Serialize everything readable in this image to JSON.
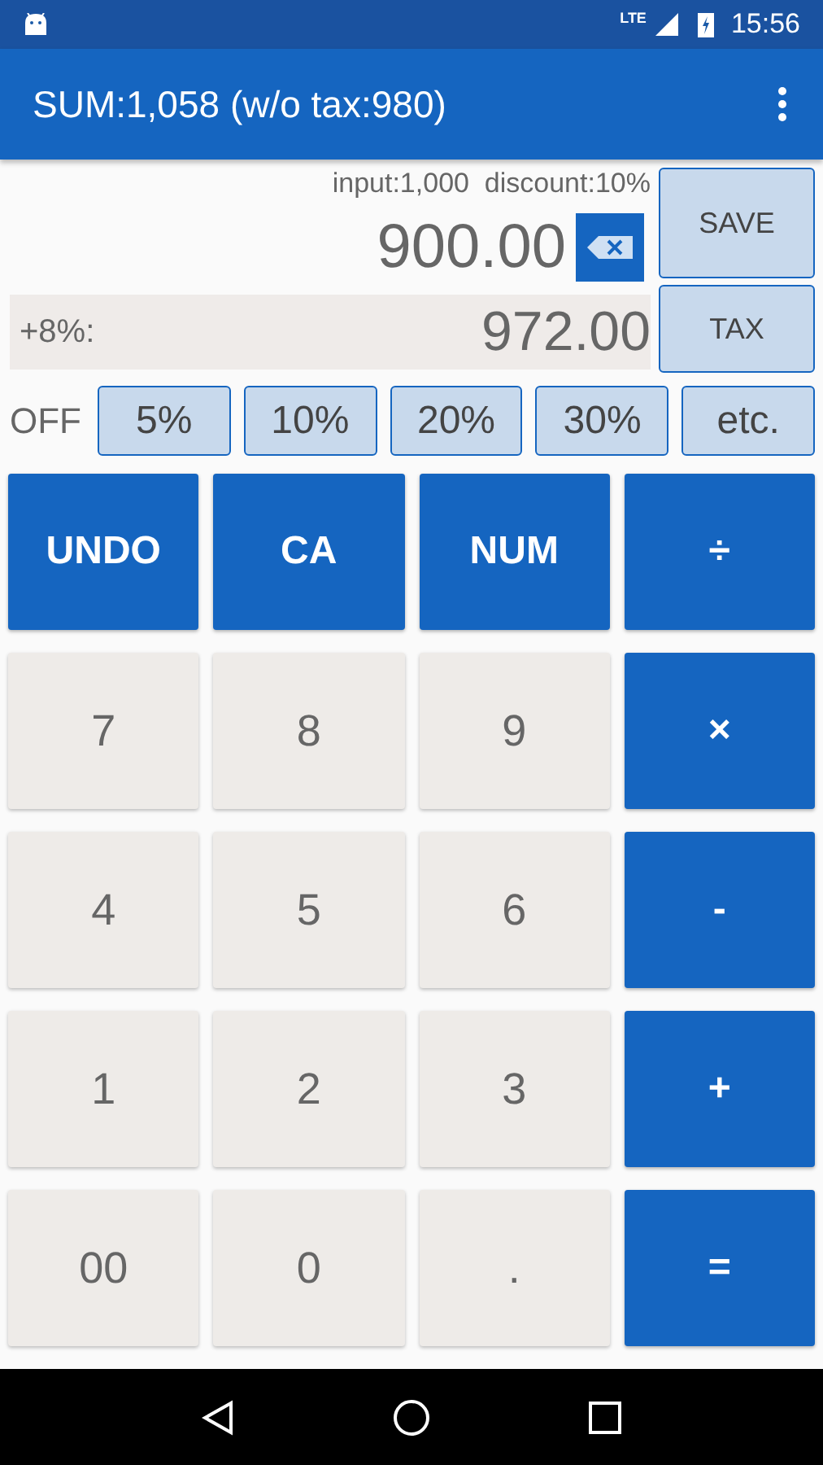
{
  "status_bar": {
    "time": "15:56",
    "network": "LTE"
  },
  "app_bar": {
    "title": "SUM:1,058 (w/o tax:980)"
  },
  "display": {
    "info": "input:1,000  discount:10%",
    "value": "900.00",
    "tax_label": "+8%:",
    "tax_value": "972.00"
  },
  "side_buttons": [
    "SAVE",
    "TAX"
  ],
  "discount": {
    "label": "OFF",
    "options": [
      "5%",
      "10%",
      "20%",
      "30%",
      "etc."
    ]
  },
  "keys": [
    {
      "label": "UNDO",
      "kind": "op"
    },
    {
      "label": "CA",
      "kind": "op"
    },
    {
      "label": "NUM",
      "kind": "op"
    },
    {
      "label": "÷",
      "kind": "op"
    },
    {
      "label": "7",
      "kind": "num"
    },
    {
      "label": "8",
      "kind": "num"
    },
    {
      "label": "9",
      "kind": "num"
    },
    {
      "label": "×",
      "kind": "op"
    },
    {
      "label": "4",
      "kind": "num"
    },
    {
      "label": "5",
      "kind": "num"
    },
    {
      "label": "6",
      "kind": "num"
    },
    {
      "label": "-",
      "kind": "op"
    },
    {
      "label": "1",
      "kind": "num"
    },
    {
      "label": "2",
      "kind": "num"
    },
    {
      "label": "3",
      "kind": "num"
    },
    {
      "label": "+",
      "kind": "op"
    },
    {
      "label": "00",
      "kind": "num"
    },
    {
      "label": "0",
      "kind": "num"
    },
    {
      "label": ".",
      "kind": "num"
    },
    {
      "label": "=",
      "kind": "op"
    }
  ]
}
